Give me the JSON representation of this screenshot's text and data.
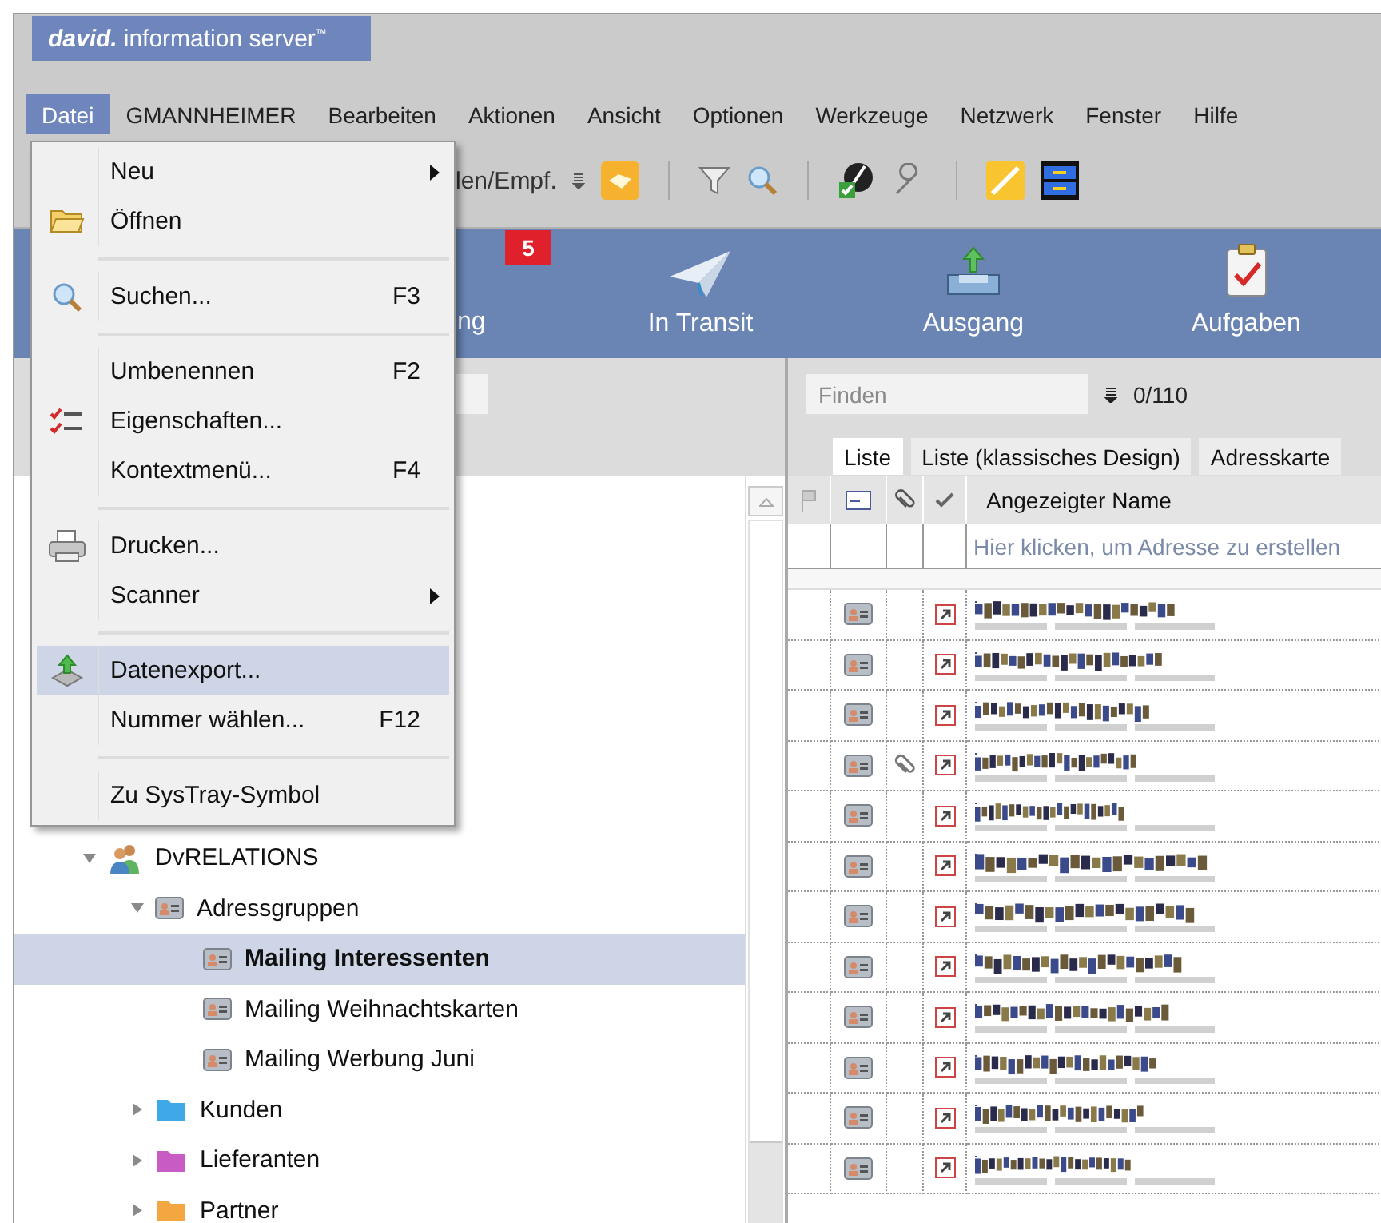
{
  "logo": {
    "brand": "david.",
    "product": "information server$^{™}$"
  },
  "menu_bar": [
    {
      "label": "Datei",
      "selected": true
    },
    {
      "label": "GMANNHEIMER",
      "selected": false
    },
    {
      "label": "Bearbeiten",
      "selected": false
    },
    {
      "label": "Aktionen",
      "selected": false
    },
    {
      "label": "Ansicht",
      "selected": false
    },
    {
      "label": "Optionen",
      "selected": false
    },
    {
      "label": "Werkzeuge",
      "selected": false
    },
    {
      "label": "Netzwerk",
      "selected": false
    },
    {
      "label": "Fenster",
      "selected": false
    },
    {
      "label": "Hilfe",
      "selected": false
    }
  ],
  "toolbar": {
    "label": "len/Empf."
  },
  "nav": {
    "partial_label": "ng",
    "badge": "5",
    "items": [
      {
        "label": "In Transit",
        "kind": "transit"
      },
      {
        "label": "Ausgang",
        "kind": "outbox"
      },
      {
        "label": "Aufgaben",
        "kind": "tasks"
      }
    ]
  },
  "file_menu": [
    {
      "kind": "item",
      "label": "Neu",
      "submenu": true,
      "highlighted": false
    },
    {
      "kind": "item",
      "label": "Öffnen",
      "highlighted": false
    },
    {
      "kind": "separator"
    },
    {
      "kind": "item",
      "label": "Suchen...",
      "shortcut": "F3",
      "highlighted": false
    },
    {
      "kind": "separator"
    },
    {
      "kind": "item",
      "label": "Umbenennen",
      "shortcut": "F2",
      "highlighted": false
    },
    {
      "kind": "item",
      "label": "Eigenschaften...",
      "highlighted": false
    },
    {
      "kind": "item",
      "label": "Kontextmenü...",
      "shortcut": "F4",
      "highlighted": false
    },
    {
      "kind": "separator"
    },
    {
      "kind": "item",
      "label": "Drucken...",
      "highlighted": false
    },
    {
      "kind": "item",
      "label": "Scanner",
      "submenu": true,
      "highlighted": false
    },
    {
      "kind": "separator"
    },
    {
      "kind": "item",
      "label": "Datenexport...",
      "highlighted": true
    },
    {
      "kind": "item",
      "label": "Nummer wählen...",
      "shortcut": "F12",
      "highlighted": false
    },
    {
      "kind": "separator"
    },
    {
      "kind": "item",
      "label": "Zu SysTray-Symbol",
      "highlighted": false
    }
  ],
  "tree": [
    {
      "label": "DvRELATIONS",
      "kind": "people",
      "expanded": true,
      "selected": false,
      "children": [
        {
          "label": "Adressgruppen",
          "kind": "card",
          "expanded": true,
          "selected": false,
          "children": [
            {
              "label": "Mailing Interessenten",
              "kind": "card",
              "selected": true
            },
            {
              "label": "Mailing Weihnachtskarten",
              "kind": "card",
              "selected": false
            },
            {
              "label": "Mailing Werbung Juni",
              "kind": "card",
              "selected": false
            }
          ]
        },
        {
          "label": "Kunden",
          "kind": "folder",
          "color": "#3fa9e8",
          "expanded": false,
          "selected": false
        },
        {
          "label": "Lieferanten",
          "kind": "folder",
          "color": "#c95cc4",
          "expanded": false,
          "selected": false
        },
        {
          "label": "Partner",
          "kind": "folder",
          "color": "#f4a640",
          "expanded": false,
          "selected": false
        }
      ]
    }
  ],
  "finder": {
    "placeholder": "Finden",
    "count": "0/110"
  },
  "view_tabs": [
    {
      "label": "Liste",
      "selected": true
    },
    {
      "label": "Liste (klassisches Design)",
      "selected": false
    },
    {
      "label": "Adresskarte",
      "selected": false
    }
  ],
  "table": {
    "name_column": "Angezeigter Name",
    "new_row_hint": "Hier klicken, um Adresse zu erstellen",
    "rows": [
      {
        "attachment": false
      },
      {
        "attachment": false
      },
      {
        "attachment": false
      },
      {
        "attachment": true
      },
      {
        "attachment": false
      },
      {
        "attachment": false
      },
      {
        "attachment": false
      },
      {
        "attachment": false
      },
      {
        "attachment": false
      },
      {
        "attachment": false
      },
      {
        "attachment": false
      },
      {
        "attachment": false
      }
    ]
  }
}
